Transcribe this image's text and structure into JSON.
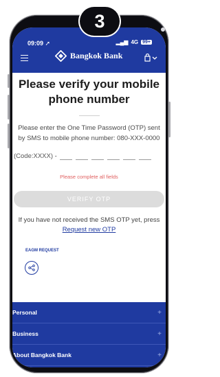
{
  "step_number": "3",
  "status_bar": {
    "time": "09:09",
    "signal": "4G",
    "battery": "99+"
  },
  "header": {
    "brand_name": "Bangkok Bank"
  },
  "main": {
    "title": "Please verify your mobile phone number",
    "instruction": "Please enter the One Time Password (OTP) sent by SMS to mobile phone number: 080-XXX-0000",
    "code_label": "(Code:XXXX) -",
    "otp_count": 6,
    "error_message": "Please complete all fields",
    "verify_button": "VERIFY OTP",
    "resend_text": "If you have not received the SMS OTP yet, press",
    "resend_link": "Request new OTP",
    "eagm_link": "EAGM REQUEST"
  },
  "footer": {
    "items": [
      "Personal",
      "Business",
      "About Bangkok Bank"
    ]
  },
  "colors": {
    "brand_blue": "#1f3aa0",
    "error_red": "#e06060",
    "disabled_button": "#dcdcdc"
  },
  "icons": [
    "menu-icon",
    "bangkok-bank-logo-icon",
    "account-icon",
    "share-icon",
    "plus-icon"
  ]
}
